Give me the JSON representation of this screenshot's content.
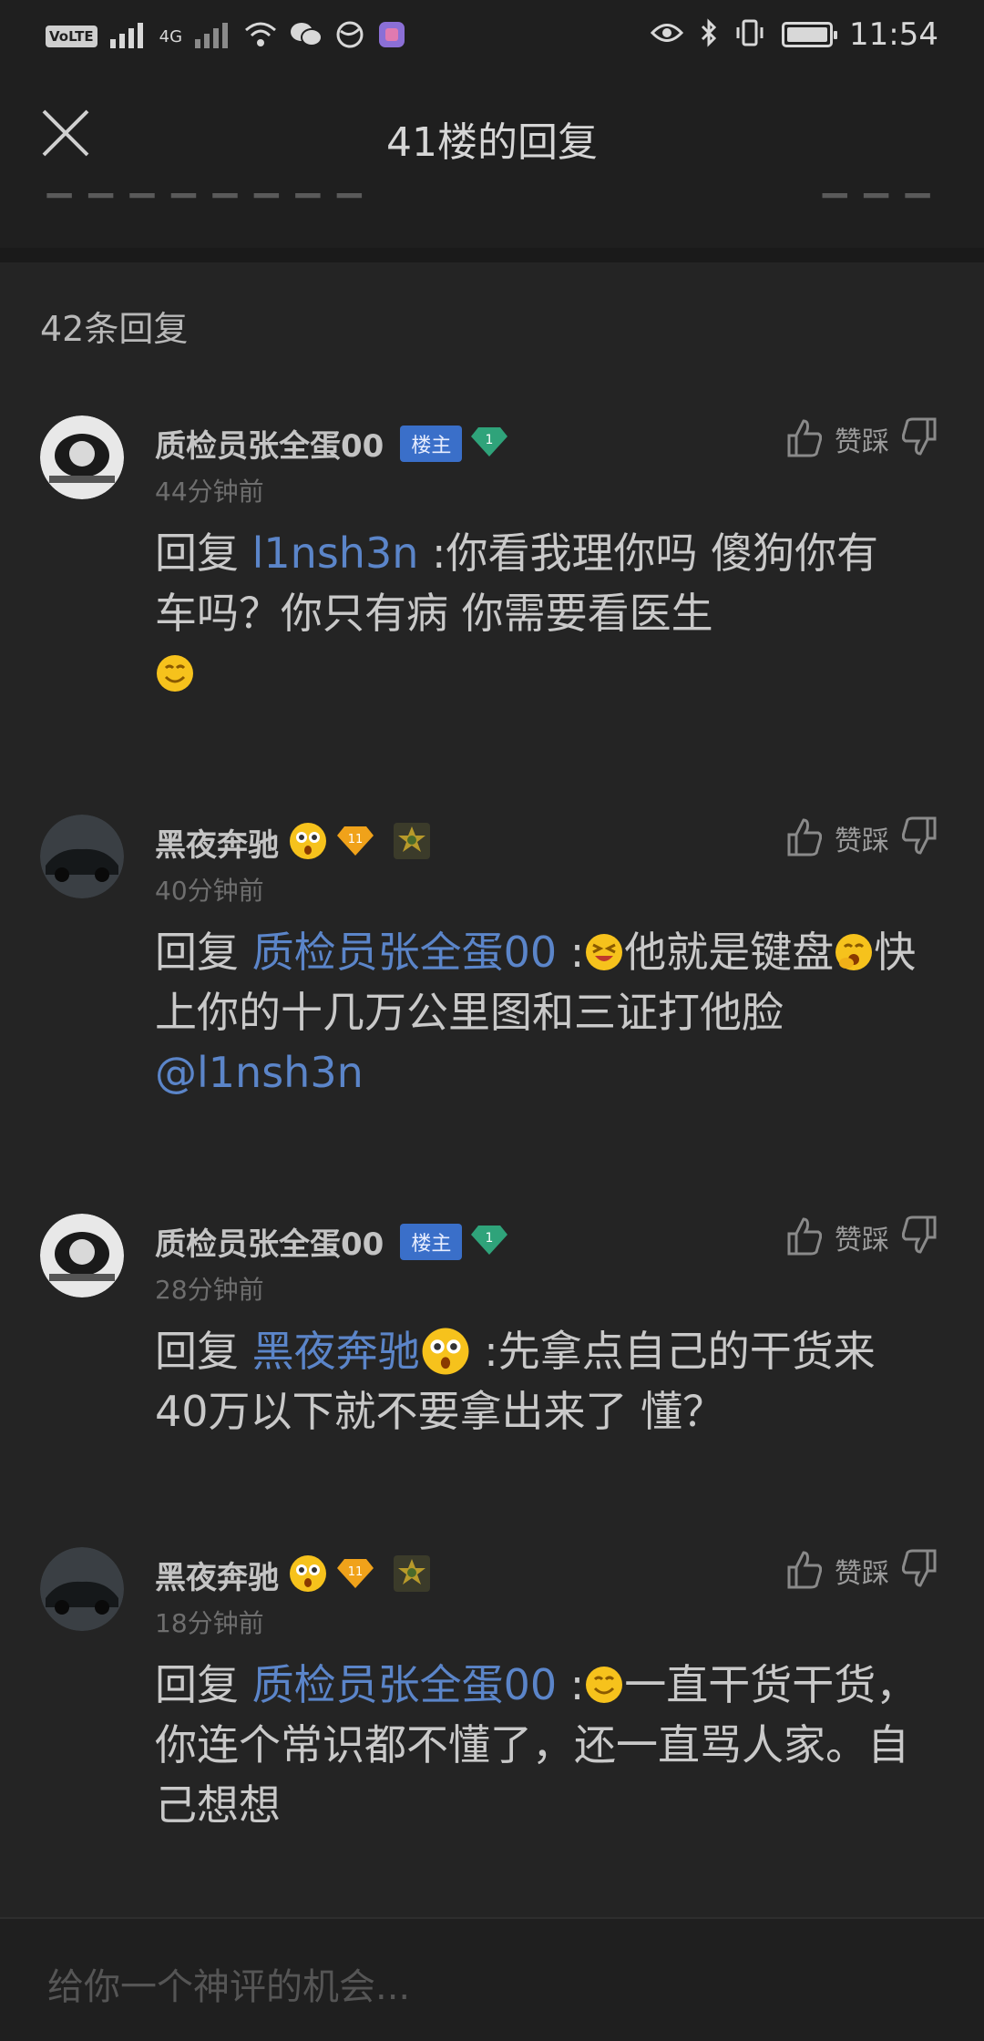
{
  "status_bar": {
    "volte": "VoLTE",
    "network": "4G",
    "time": "11:54",
    "icons": [
      "signal-icon",
      "wifi-icon",
      "wechat-icon",
      "browser-icon",
      "app-icon",
      "eye-icon",
      "bluetooth-icon",
      "vibrate-icon",
      "battery-icon"
    ]
  },
  "nav": {
    "title": "41楼的回复"
  },
  "reply_count": "42条回复",
  "vote_label": "赞踩",
  "comments": [
    {
      "username": "质检员张全蛋00",
      "badge": "楼主",
      "level": "1",
      "time": "44分钟前",
      "prefix": "回复 ",
      "mention": "l1nsh3n",
      "text": " :你看我理你吗 傻狗你有车吗？你只有病 你需要看医生"
    },
    {
      "username": "黑夜奔驰",
      "level": "11",
      "time": "40分钟前",
      "prefix": "回复 ",
      "mention": "质检员张全蛋00",
      "text_a": " :",
      "text_b": "他就是键盘",
      "text_c": "快上你的十几万公里图和三证打他脸",
      "mention2": "@l1nsh3n"
    },
    {
      "username": "质检员张全蛋00",
      "badge": "楼主",
      "level": "1",
      "time": "28分钟前",
      "prefix": "回复 ",
      "mention": "黑夜奔驰",
      "text": " :先拿点自己的干货来 40万以下就不要拿出来了 懂？"
    },
    {
      "username": "黑夜奔驰",
      "level": "11",
      "time": "18分钟前",
      "prefix": "回复 ",
      "mention": "质检员张全蛋00",
      "text_a": " :",
      "text_b": "一直干货干货，你连个常识都不懂了，还一直骂人家。自己想想"
    }
  ],
  "input": {
    "placeholder": "给你一个神评的机会..."
  }
}
